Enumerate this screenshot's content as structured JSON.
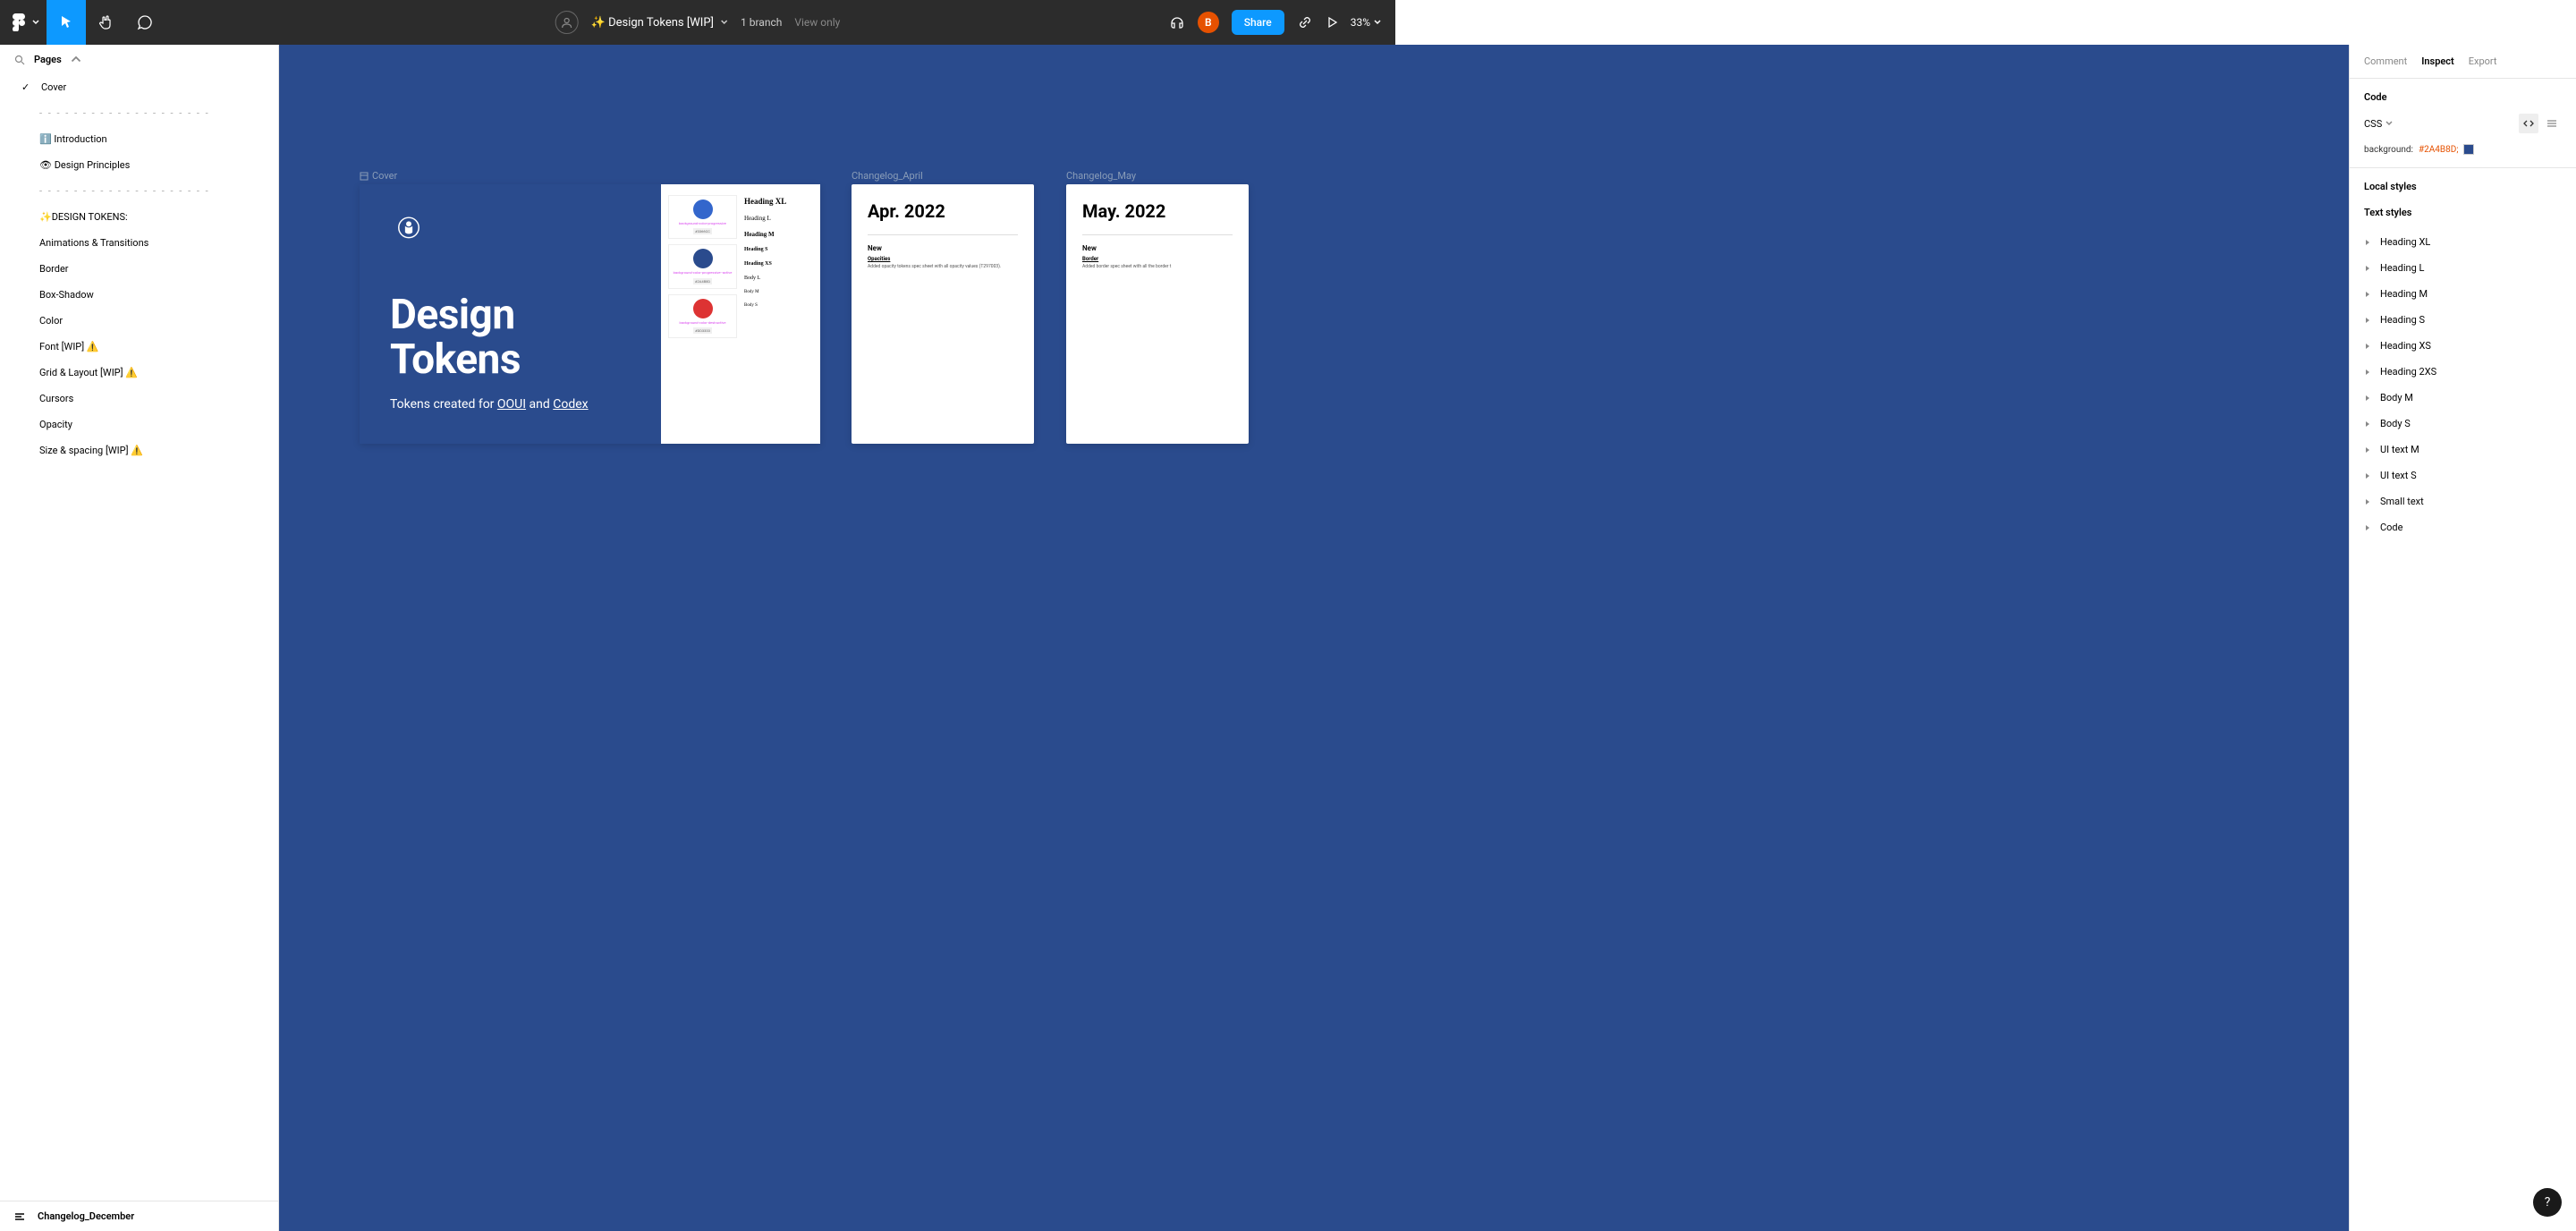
{
  "toolbar": {
    "file_title": "✨ Design Tokens [WIP]",
    "branch": "1 branch",
    "view_mode": "View only",
    "avatar_letter": "B",
    "share_label": "Share",
    "zoom": "33%"
  },
  "left_panel": {
    "pages_label": "Pages",
    "pages": [
      {
        "label": "Cover",
        "checked": true
      },
      {
        "label": "- - - - - - - - - - - - - - - - - - - -",
        "divider": true
      },
      {
        "label": "ℹ️ Introduction"
      },
      {
        "label": "👁 Design Principles"
      },
      {
        "label": "- - - - - - - - - - - - - - - - - - - -",
        "divider": true
      },
      {
        "label": "✨DESIGN TOKENS:"
      },
      {
        "label": "Animations & Transitions"
      },
      {
        "label": "Border"
      },
      {
        "label": "Box-Shadow"
      },
      {
        "label": "Color"
      },
      {
        "label": "Font [WIP] ⚠️"
      },
      {
        "label": "Grid & Layout [WIP] ⚠️"
      },
      {
        "label": "Cursors"
      },
      {
        "label": "Opacity"
      },
      {
        "label": "Size & spacing [WIP] ⚠️"
      }
    ],
    "footer_layer": "Changelog_December"
  },
  "canvas": {
    "bg_color": "#2A4B8D",
    "cover_label": "Cover",
    "cover_title_l1": "Design",
    "cover_title_l2": "Tokens",
    "cover_sub_prefix": "Tokens created for ",
    "cover_sub_link1": "OOUI",
    "cover_sub_and": " and ",
    "cover_sub_link2": "Codex",
    "type_specimen": [
      "Heading XL",
      "Heading L",
      "Heading M",
      "Heading S",
      "Heading XS",
      "Body L",
      "Body M",
      "Body S"
    ],
    "swatch1_label": "background-color-progressive",
    "swatch1_code": "#3366CC",
    "swatch2_label": "background-color-progressive--active",
    "swatch2_code": "#2A4B8D",
    "swatch3_label": "background-color-destructive",
    "swatch3_code": "#DD3333",
    "changelog_april": {
      "frame_label": "Changelog_April",
      "title": "Apr. 2022",
      "section": "New",
      "sub": "Opacities",
      "body": "Added opacity tokens spec sheet with all opacity values (T297003)."
    },
    "changelog_may": {
      "frame_label": "Changelog_May",
      "title": "May. 2022",
      "section": "New",
      "sub": "Border",
      "body": "Added border spec sheet with all the border t"
    }
  },
  "right_panel": {
    "tabs": {
      "comment": "Comment",
      "inspect": "Inspect",
      "export": "Export"
    },
    "code_label": "Code",
    "lang": "CSS",
    "css_property": "background:",
    "css_value": "#2A4B8D",
    "local_styles_label": "Local styles",
    "text_styles_label": "Text styles",
    "text_styles": [
      "Heading XL",
      "Heading L",
      "Heading M",
      "Heading S",
      "Heading XS",
      "Heading 2XS",
      "Body M",
      "Body S",
      "UI text M",
      "UI text S",
      "Small text",
      "Code"
    ]
  },
  "help_label": "?"
}
